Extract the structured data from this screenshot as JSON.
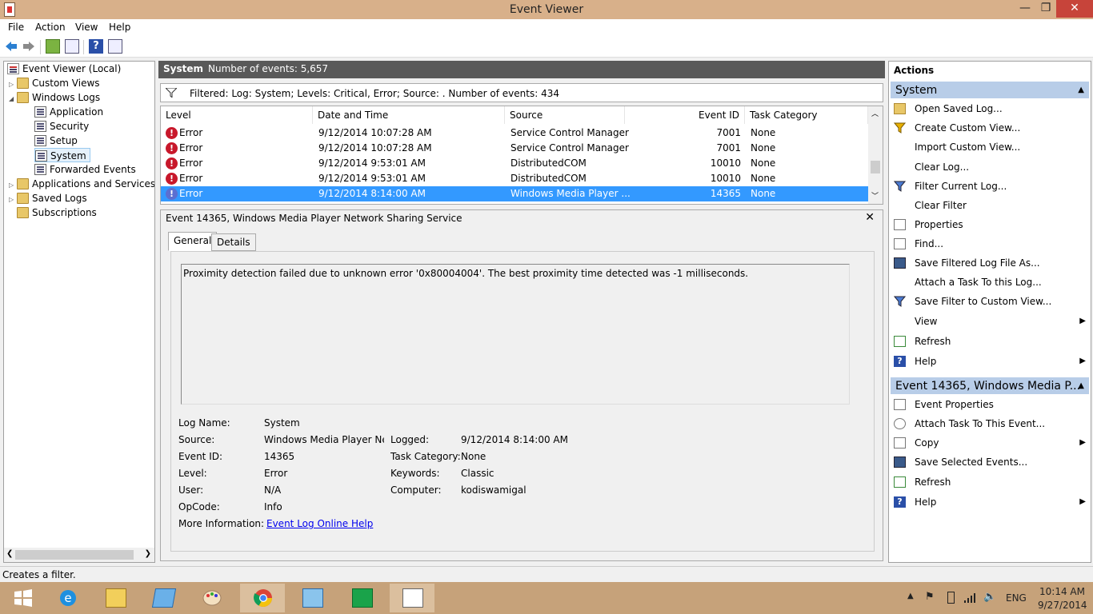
{
  "window": {
    "title": "Event Viewer",
    "min": "—",
    "max": "❐",
    "close": "✕"
  },
  "menu": [
    "File",
    "Action",
    "View",
    "Help"
  ],
  "tree": {
    "root": "Event Viewer (Local)",
    "custom_views": "Custom Views",
    "windows_logs": "Windows Logs",
    "application": "Application",
    "security": "Security",
    "setup": "Setup",
    "system": "System",
    "forwarded": "Forwarded Events",
    "apps_services": "Applications and Services Lo",
    "saved_logs": "Saved Logs",
    "subscriptions": "Subscriptions"
  },
  "center": {
    "log_name": "System",
    "count": "Number of events: 5,657",
    "filter": "Filtered: Log: System; Levels: Critical, Error; Source: . Number of events: 434"
  },
  "grid": {
    "columns": [
      "Level",
      "Date and Time",
      "Source",
      "Event ID",
      "Task Category"
    ],
    "rows": [
      {
        "level": "Error",
        "date": "9/12/2014 10:07:28 AM",
        "source": "Service Control Manager",
        "id": "7001",
        "task": "None"
      },
      {
        "level": "Error",
        "date": "9/12/2014 10:07:28 AM",
        "source": "Service Control Manager",
        "id": "7001",
        "task": "None"
      },
      {
        "level": "Error",
        "date": "9/12/2014 9:53:01 AM",
        "source": "DistributedCOM",
        "id": "10010",
        "task": "None"
      },
      {
        "level": "Error",
        "date": "9/12/2014 9:53:01 AM",
        "source": "DistributedCOM",
        "id": "10010",
        "task": "None"
      },
      {
        "level": "Error",
        "date": "9/12/2014 8:14:00 AM",
        "source": "Windows Media Player ...",
        "id": "14365",
        "task": "None"
      }
    ]
  },
  "detail": {
    "title": "Event 14365, Windows Media Player Network Sharing Service",
    "tab_general": "General",
    "tab_details": "Details",
    "description": "Proximity detection failed due to unknown error '0x80004004'.  The best proximity time detected was -1 milliseconds.",
    "log_name_label": "Log Name:",
    "log_name": "System",
    "source_label": "Source:",
    "source": "Windows Media Player Netw",
    "logged_label": "Logged:",
    "logged": "9/12/2014 8:14:00 AM",
    "event_id_label": "Event ID:",
    "event_id": "14365",
    "task_label": "Task Category:",
    "task": "None",
    "level_label": "Level:",
    "level": "Error",
    "keywords_label": "Keywords:",
    "keywords": "Classic",
    "user_label": "User:",
    "user": "N/A",
    "computer_label": "Computer:",
    "computer": "kodiswamigal",
    "opcode_label": "OpCode:",
    "opcode": "Info",
    "more_label": "More Information:",
    "more_link": "Event Log Online Help"
  },
  "actions": {
    "header": "Actions",
    "sec1": "System",
    "sec1_items": [
      "Open Saved Log...",
      "Create Custom View...",
      "Import Custom View...",
      "Clear Log...",
      "Filter Current Log...",
      "Clear Filter",
      "Properties",
      "Find...",
      "Save Filtered Log File As...",
      "Attach a Task To this Log...",
      "Save Filter to Custom View...",
      "View",
      "Refresh",
      "Help"
    ],
    "sec2": "Event 14365, Windows Media P...",
    "sec2_items": [
      "Event Properties",
      "Attach Task To This Event...",
      "Copy",
      "Save Selected Events...",
      "Refresh",
      "Help"
    ]
  },
  "status": "Creates a filter.",
  "taskbar": {
    "lang": "ENG",
    "time": "10:14 AM",
    "date": "9/27/2014"
  }
}
